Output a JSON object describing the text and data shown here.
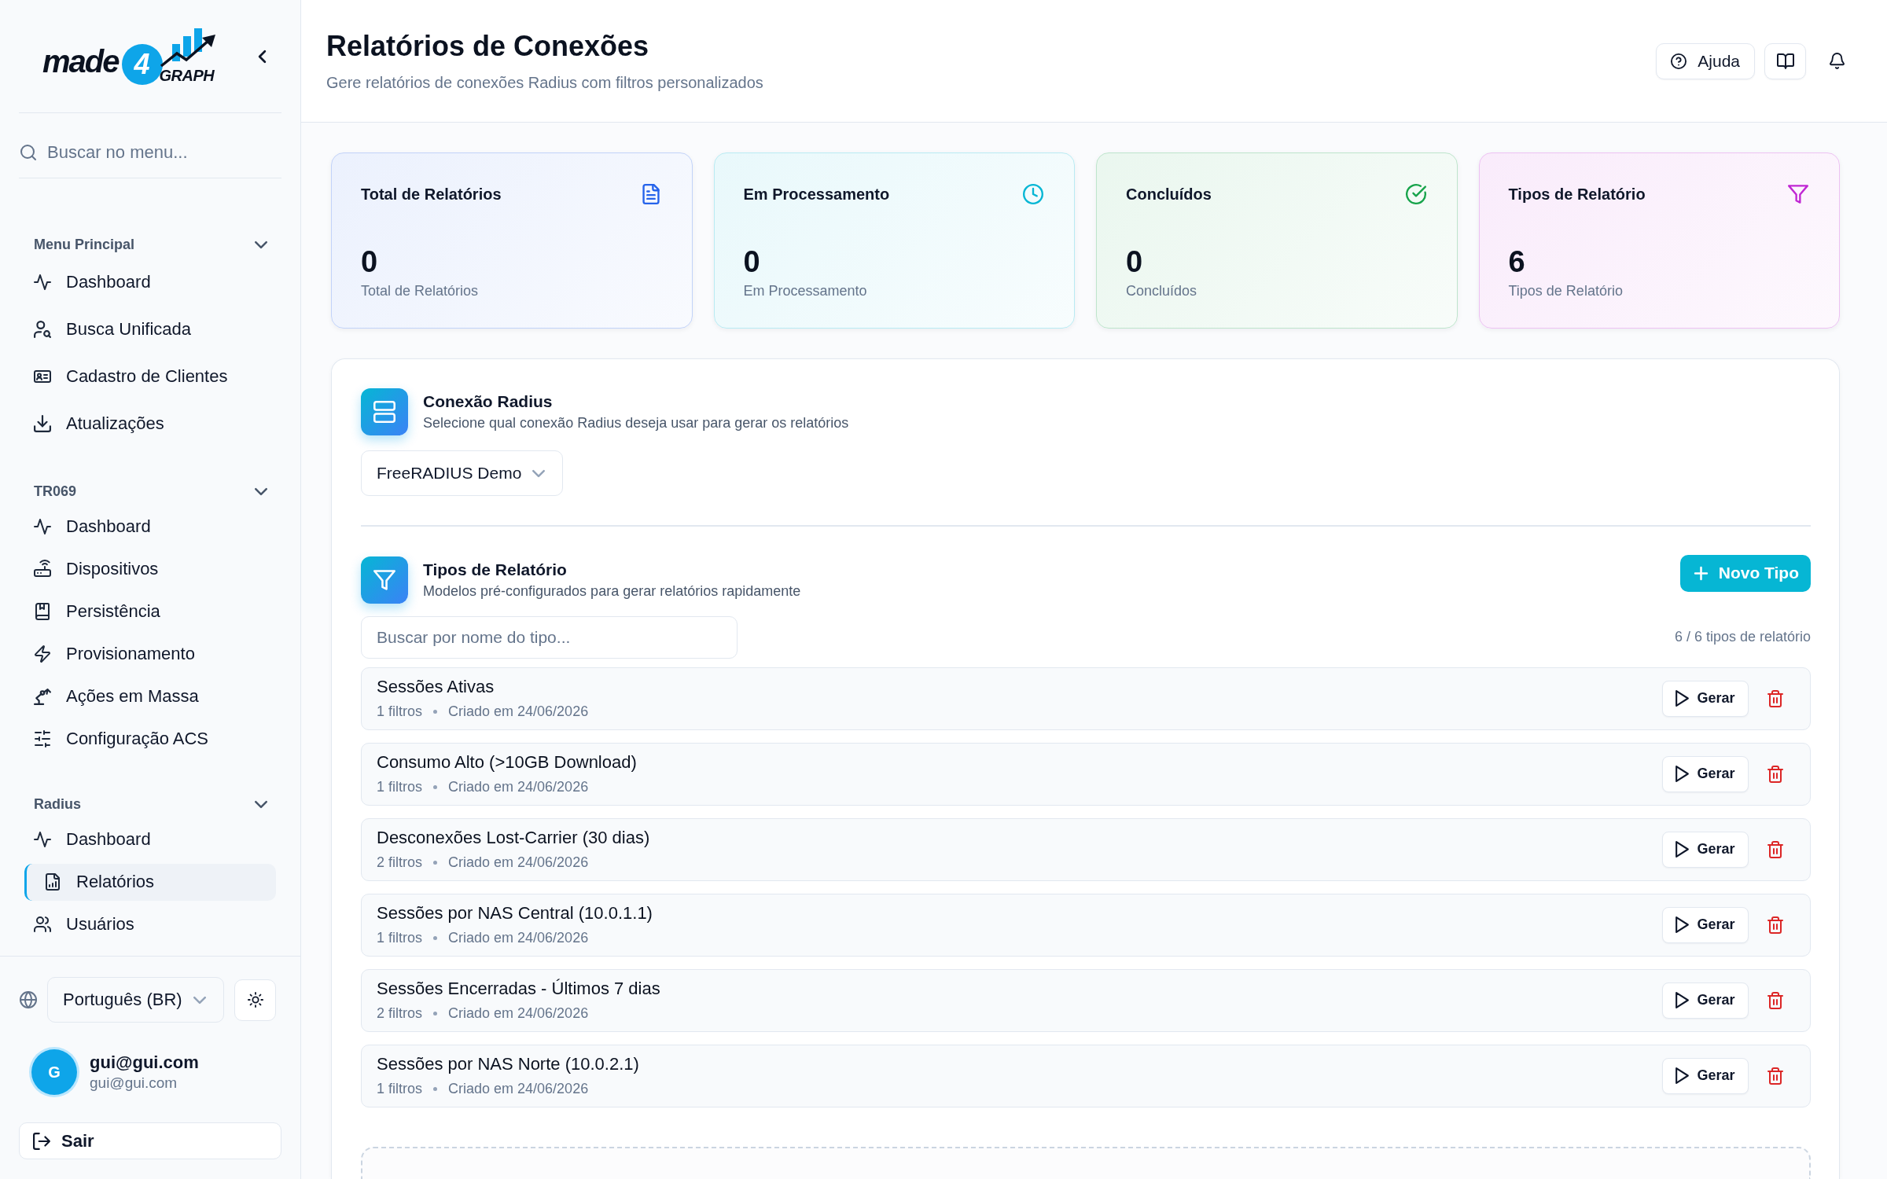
{
  "sidebar": {
    "brand": {
      "wordmark": "made",
      "badge": "4",
      "tagline": "GRAPH"
    },
    "search": {
      "placeholder": "Buscar no menu..."
    },
    "groups": [
      {
        "title": "Menu Principal",
        "expanded": true,
        "items": [
          {
            "label": "Dashboard",
            "selected": false
          },
          {
            "label": "Busca Unificada",
            "selected": false
          },
          {
            "label": "Cadastro de Clientes",
            "selected": false
          },
          {
            "label": "Atualizações",
            "selected": false
          }
        ]
      },
      {
        "title": "TR069",
        "expanded": true,
        "items": [
          {
            "label": "Dashboard",
            "selected": false
          },
          {
            "label": "Dispositivos",
            "selected": false
          },
          {
            "label": "Persistência",
            "selected": false
          },
          {
            "label": "Provisionamento",
            "selected": false
          },
          {
            "label": "Ações em Massa",
            "selected": false
          },
          {
            "label": "Configuração ACS",
            "selected": false
          }
        ]
      },
      {
        "title": "Radius",
        "expanded": true,
        "items": [
          {
            "label": "Dashboard",
            "selected": false
          },
          {
            "label": "Relatórios",
            "selected": true
          },
          {
            "label": "Usuários",
            "selected": false
          }
        ]
      }
    ],
    "language": {
      "value": "Português (BR)"
    },
    "user": {
      "initial": "G",
      "name": "gui@gui.com",
      "email": "gui@gui.com"
    },
    "logout": {
      "label": "Sair"
    }
  },
  "header": {
    "title": "Relatórios de Conexões",
    "subtitle": "Gere relatórios de conexões Radius com filtros personalizados",
    "help_button": {
      "label": "Ajuda"
    }
  },
  "stats": [
    {
      "title": "Total de Relatórios",
      "value": "0",
      "caption": "Total de Relatórios",
      "color": "#2563eb"
    },
    {
      "title": "Em Processamento",
      "value": "0",
      "caption": "Em Processamento",
      "color": "#06b6d4"
    },
    {
      "title": "Concluídos",
      "value": "0",
      "caption": "Concluídos",
      "color": "#16a34a"
    },
    {
      "title": "Tipos de Relatório",
      "value": "6",
      "caption": "Tipos de Relatório",
      "color": "#c026d3"
    }
  ],
  "connection": {
    "title": "Conexão Radius",
    "subtitle": "Selecione qual conexão Radius deseja usar para gerar os relatórios",
    "select": {
      "value": "FreeRADIUS Demo"
    }
  },
  "report_types": {
    "title": "Tipos de Relatório",
    "subtitle": "Modelos pré-configurados para gerar relatórios rapidamente",
    "new_button": {
      "label": "Novo Tipo"
    },
    "search": {
      "placeholder": "Buscar por nome do tipo..."
    },
    "count": "6 / 6 tipos de relatório",
    "items": [
      {
        "name": "Sessões Ativas",
        "filters": "1 filtros",
        "created": "Criado em 24/06/2026",
        "action": "Gerar"
      },
      {
        "name": "Consumo Alto (>10GB Download)",
        "filters": "1 filtros",
        "created": "Criado em 24/06/2026",
        "action": "Gerar"
      },
      {
        "name": "Desconexões Lost-Carrier (30 dias)",
        "filters": "2 filtros",
        "created": "Criado em 24/06/2026",
        "action": "Gerar"
      },
      {
        "name": "Sessões por NAS Central (10.0.1.1)",
        "filters": "1 filtros",
        "created": "Criado em 24/06/2026",
        "action": "Gerar"
      },
      {
        "name": "Sessões Encerradas - Últimos 7 dias",
        "filters": "2 filtros",
        "created": "Criado em 24/06/2026",
        "action": "Gerar"
      },
      {
        "name": "Sessões por NAS Norte (10.0.2.1)",
        "filters": "1 filtros",
        "created": "Criado em 24/06/2026",
        "action": "Gerar"
      }
    ]
  }
}
